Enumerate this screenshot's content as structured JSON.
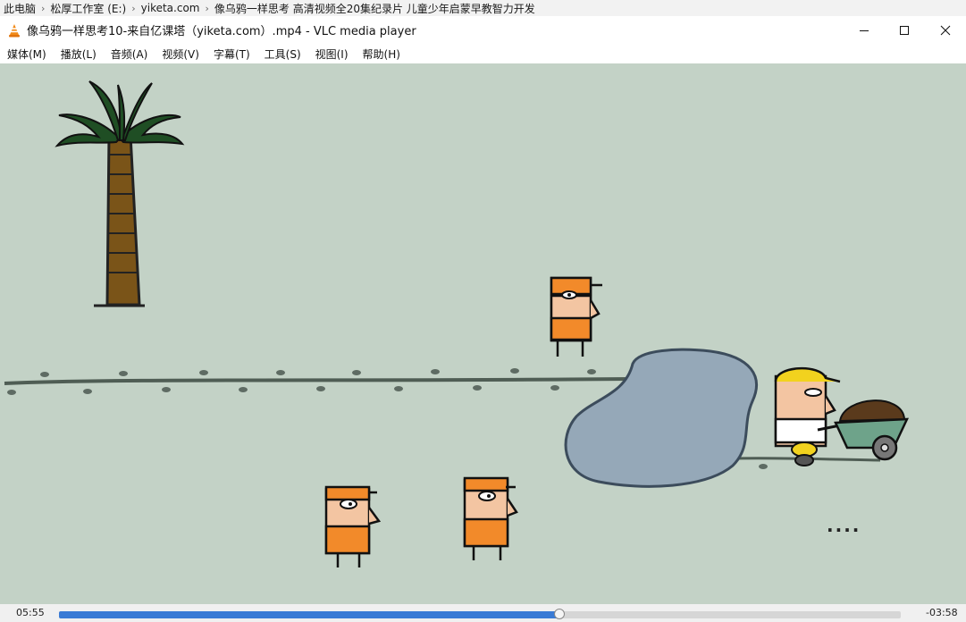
{
  "breadcrumb": [
    "此电脑",
    "松厚工作室 (E:)",
    "yiketa.com",
    "像乌鸦一样思考 高清视频全20集纪录片 儿童少年启蒙早教智力开发"
  ],
  "window": {
    "title": "像乌鸦一样思考10-来自亿课塔（yiketa.com）.mp4 - VLC media player"
  },
  "menu": [
    "媒体(M)",
    "播放(L)",
    "音频(A)",
    "视频(V)",
    "字幕(T)",
    "工具(S)",
    "视图(I)",
    "帮助(H)"
  ],
  "player": {
    "elapsed": "05:55",
    "remaining": "-03:58",
    "progress": 0.595
  },
  "video": {
    "subtitle_text": "...."
  },
  "colors": {
    "accent": "#3a7bd5",
    "video_bg": "#c3d2c6"
  },
  "icons": {
    "app": "vlc-cone-icon",
    "minimize": "minimize-icon",
    "maximize": "maximize-icon",
    "close": "close-icon"
  }
}
